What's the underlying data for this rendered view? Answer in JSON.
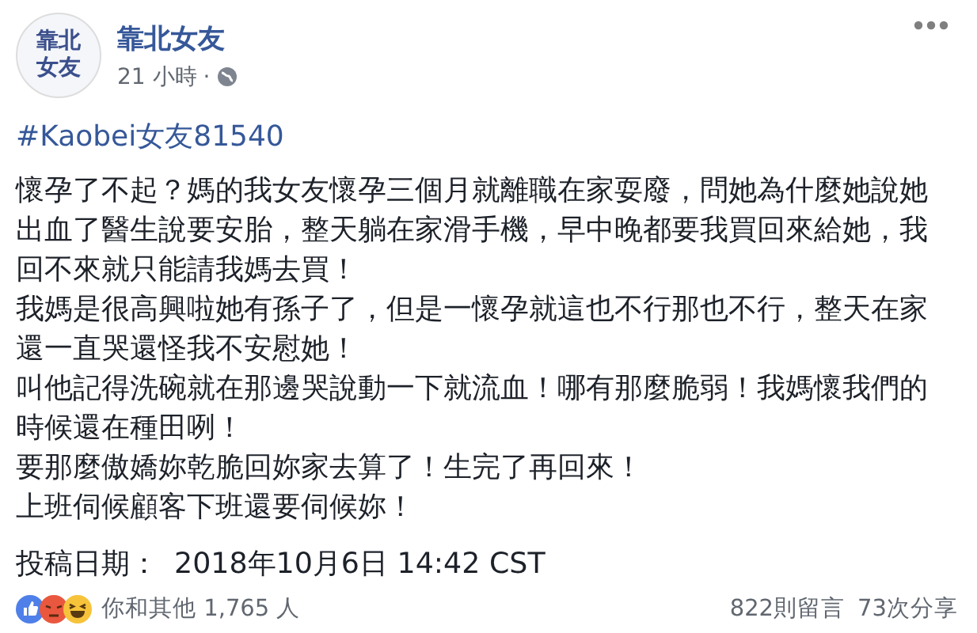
{
  "header": {
    "avatar_text": [
      "靠北",
      "女友"
    ],
    "page_name": "靠北女友",
    "time": "21 小時",
    "separator": "·"
  },
  "hashtag": "#Kaobei女友81540",
  "paragraphs": [
    "懷孕了不起？媽的我女友懷孕三個月就離職在家耍廢，問她為什麼她說她出血了醫生說要安胎，整天躺在家滑手機，早中晚都要我買回來給她，我回不來就只能請我媽去買！",
    "我媽是很高興啦她有孫子了，但是一懷孕就這也不行那也不行，整天在家還一直哭還怪我不安慰她！",
    "叫他記得洗碗就在那邊哭說動一下就流血！哪有那麼脆弱！我媽懷我們的時候還在種田咧！",
    "要那麼傲嬌妳乾脆回妳家去算了！生完了再回來！",
    "上班伺候顧客下班還要伺候妳！"
  ],
  "post_date": {
    "label": "投稿日期：",
    "value": "2018年10月6日 14:42 CST"
  },
  "reactions": {
    "icons": [
      {
        "kind": "like"
      },
      {
        "kind": "angry"
      },
      {
        "kind": "haha"
      }
    ],
    "summary": "你和其他 1,765 人",
    "comments": "822則留言",
    "shares": "73次分享"
  }
}
